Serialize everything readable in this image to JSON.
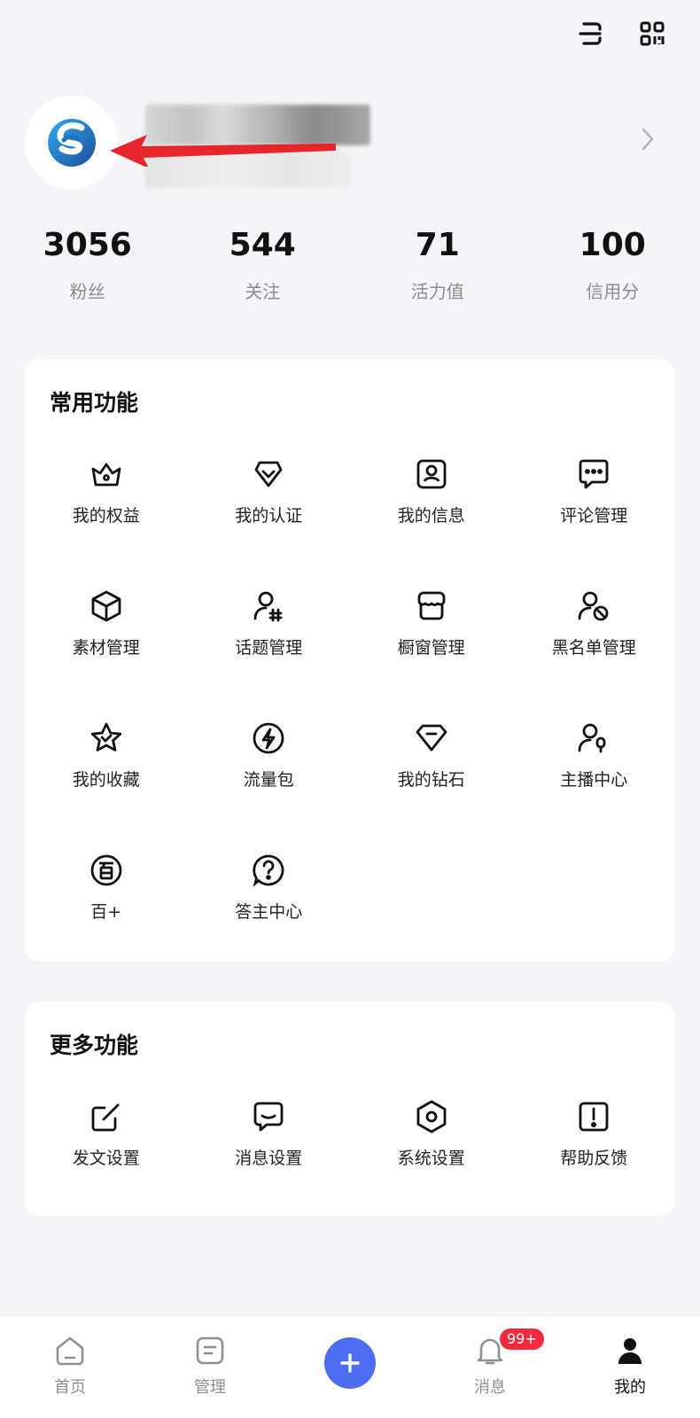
{
  "header": {
    "scan_icon": "scan-icon",
    "qrcode_icon": "qrcode-icon"
  },
  "profile": {
    "avatar_icon": "app-logo",
    "chevron_icon": "chevron-right-icon"
  },
  "stats": [
    {
      "value": "3056",
      "label": "粉丝"
    },
    {
      "value": "544",
      "label": "关注"
    },
    {
      "value": "71",
      "label": "活力值"
    },
    {
      "value": "100",
      "label": "信用分"
    }
  ],
  "common": {
    "title": "常用功能",
    "items": [
      {
        "label": "我的权益",
        "icon": "crown-icon"
      },
      {
        "label": "我的认证",
        "icon": "badge-check-icon"
      },
      {
        "label": "我的信息",
        "icon": "profile-card-icon"
      },
      {
        "label": "评论管理",
        "icon": "comment-icon"
      },
      {
        "label": "素材管理",
        "icon": "cube-icon"
      },
      {
        "label": "话题管理",
        "icon": "topic-icon"
      },
      {
        "label": "橱窗管理",
        "icon": "store-icon"
      },
      {
        "label": "黑名单管理",
        "icon": "block-user-icon"
      },
      {
        "label": "我的收藏",
        "icon": "star-icon"
      },
      {
        "label": "流量包",
        "icon": "lightning-icon"
      },
      {
        "label": "我的钻石",
        "icon": "diamond-icon"
      },
      {
        "label": "主播中心",
        "icon": "anchor-icon"
      },
      {
        "label": "百+",
        "icon": "bai-plus-icon"
      },
      {
        "label": "答主中心",
        "icon": "question-icon"
      }
    ]
  },
  "more": {
    "title": "更多功能",
    "items": [
      {
        "label": "发文设置",
        "icon": "edit-icon"
      },
      {
        "label": "消息设置",
        "icon": "message-icon"
      },
      {
        "label": "系统设置",
        "icon": "settings-icon"
      },
      {
        "label": "帮助反馈",
        "icon": "feedback-icon"
      }
    ]
  },
  "tabbar": {
    "tabs": [
      {
        "label": "首页",
        "icon": "home-icon"
      },
      {
        "label": "管理",
        "icon": "manage-icon"
      },
      {
        "label": "",
        "icon": "add-icon"
      },
      {
        "label": "消息",
        "icon": "bell-icon",
        "badge": "99+"
      },
      {
        "label": "我的",
        "icon": "user-icon",
        "active": true
      }
    ]
  },
  "colors": {
    "accent": "#4e6ef2",
    "badge": "#f5293d",
    "arrow": "#e8252a",
    "logo": "#1d73c9"
  }
}
